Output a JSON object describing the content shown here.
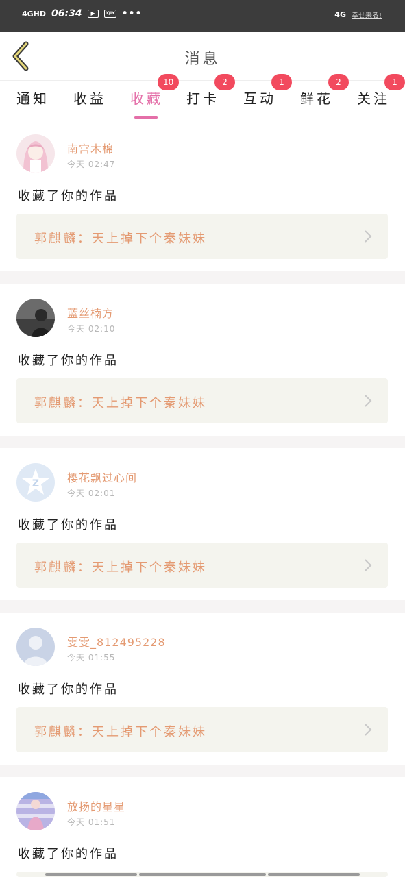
{
  "status_bar": {
    "signal": "4GHD",
    "time": "06:34",
    "app_icon_1": "▶",
    "app_icon_2": "iQIY",
    "dots": "•••",
    "network": "4G",
    "carrier": "幸せ来る!"
  },
  "header": {
    "title": "消息"
  },
  "tabs": [
    {
      "label": "通知",
      "badge": ""
    },
    {
      "label": "收益",
      "badge": ""
    },
    {
      "label": "收藏",
      "badge": "10",
      "active": true
    },
    {
      "label": "打卡",
      "badge": "2"
    },
    {
      "label": "互动",
      "badge": "1"
    },
    {
      "label": "鲜花",
      "badge": "2"
    },
    {
      "label": "关注",
      "badge": "1"
    }
  ],
  "messages": [
    {
      "user": "南宫木棉",
      "time": "今天 02:47",
      "action": "收藏了你的作品",
      "work": "郭麒麟：天上掉下个秦妹妹",
      "avatar": "anime-girl-avatar"
    },
    {
      "user": "蓝丝楠方",
      "time": "今天 02:10",
      "action": "收藏了你的作品",
      "work": "郭麒麟：天上掉下个秦妹妹",
      "avatar": "dark-photo-avatar"
    },
    {
      "user": "樱花飘过心间",
      "time": "今天 02:01",
      "action": "收藏了你的作品",
      "work": "郭麒麟：天上掉下个秦妹妹",
      "avatar": "qzone-star-avatar"
    },
    {
      "user": "雯雯_812495228",
      "time": "今天 01:55",
      "action": "收藏了你的作品",
      "work": "郭麒麟：天上掉下个秦妹妹",
      "avatar": "default-person-avatar"
    },
    {
      "user": "放扬的星星",
      "time": "今天 01:51",
      "action": "收藏了你的作品",
      "work": "",
      "avatar": "girl-photo-avatar"
    }
  ],
  "colors": {
    "accent_pink": "#e46fa8",
    "badge_red": "#f24a5e",
    "username_orange": "#e49a72",
    "work_bg": "#f4f4ee",
    "status_bar_bg": "#3c3c3c"
  }
}
